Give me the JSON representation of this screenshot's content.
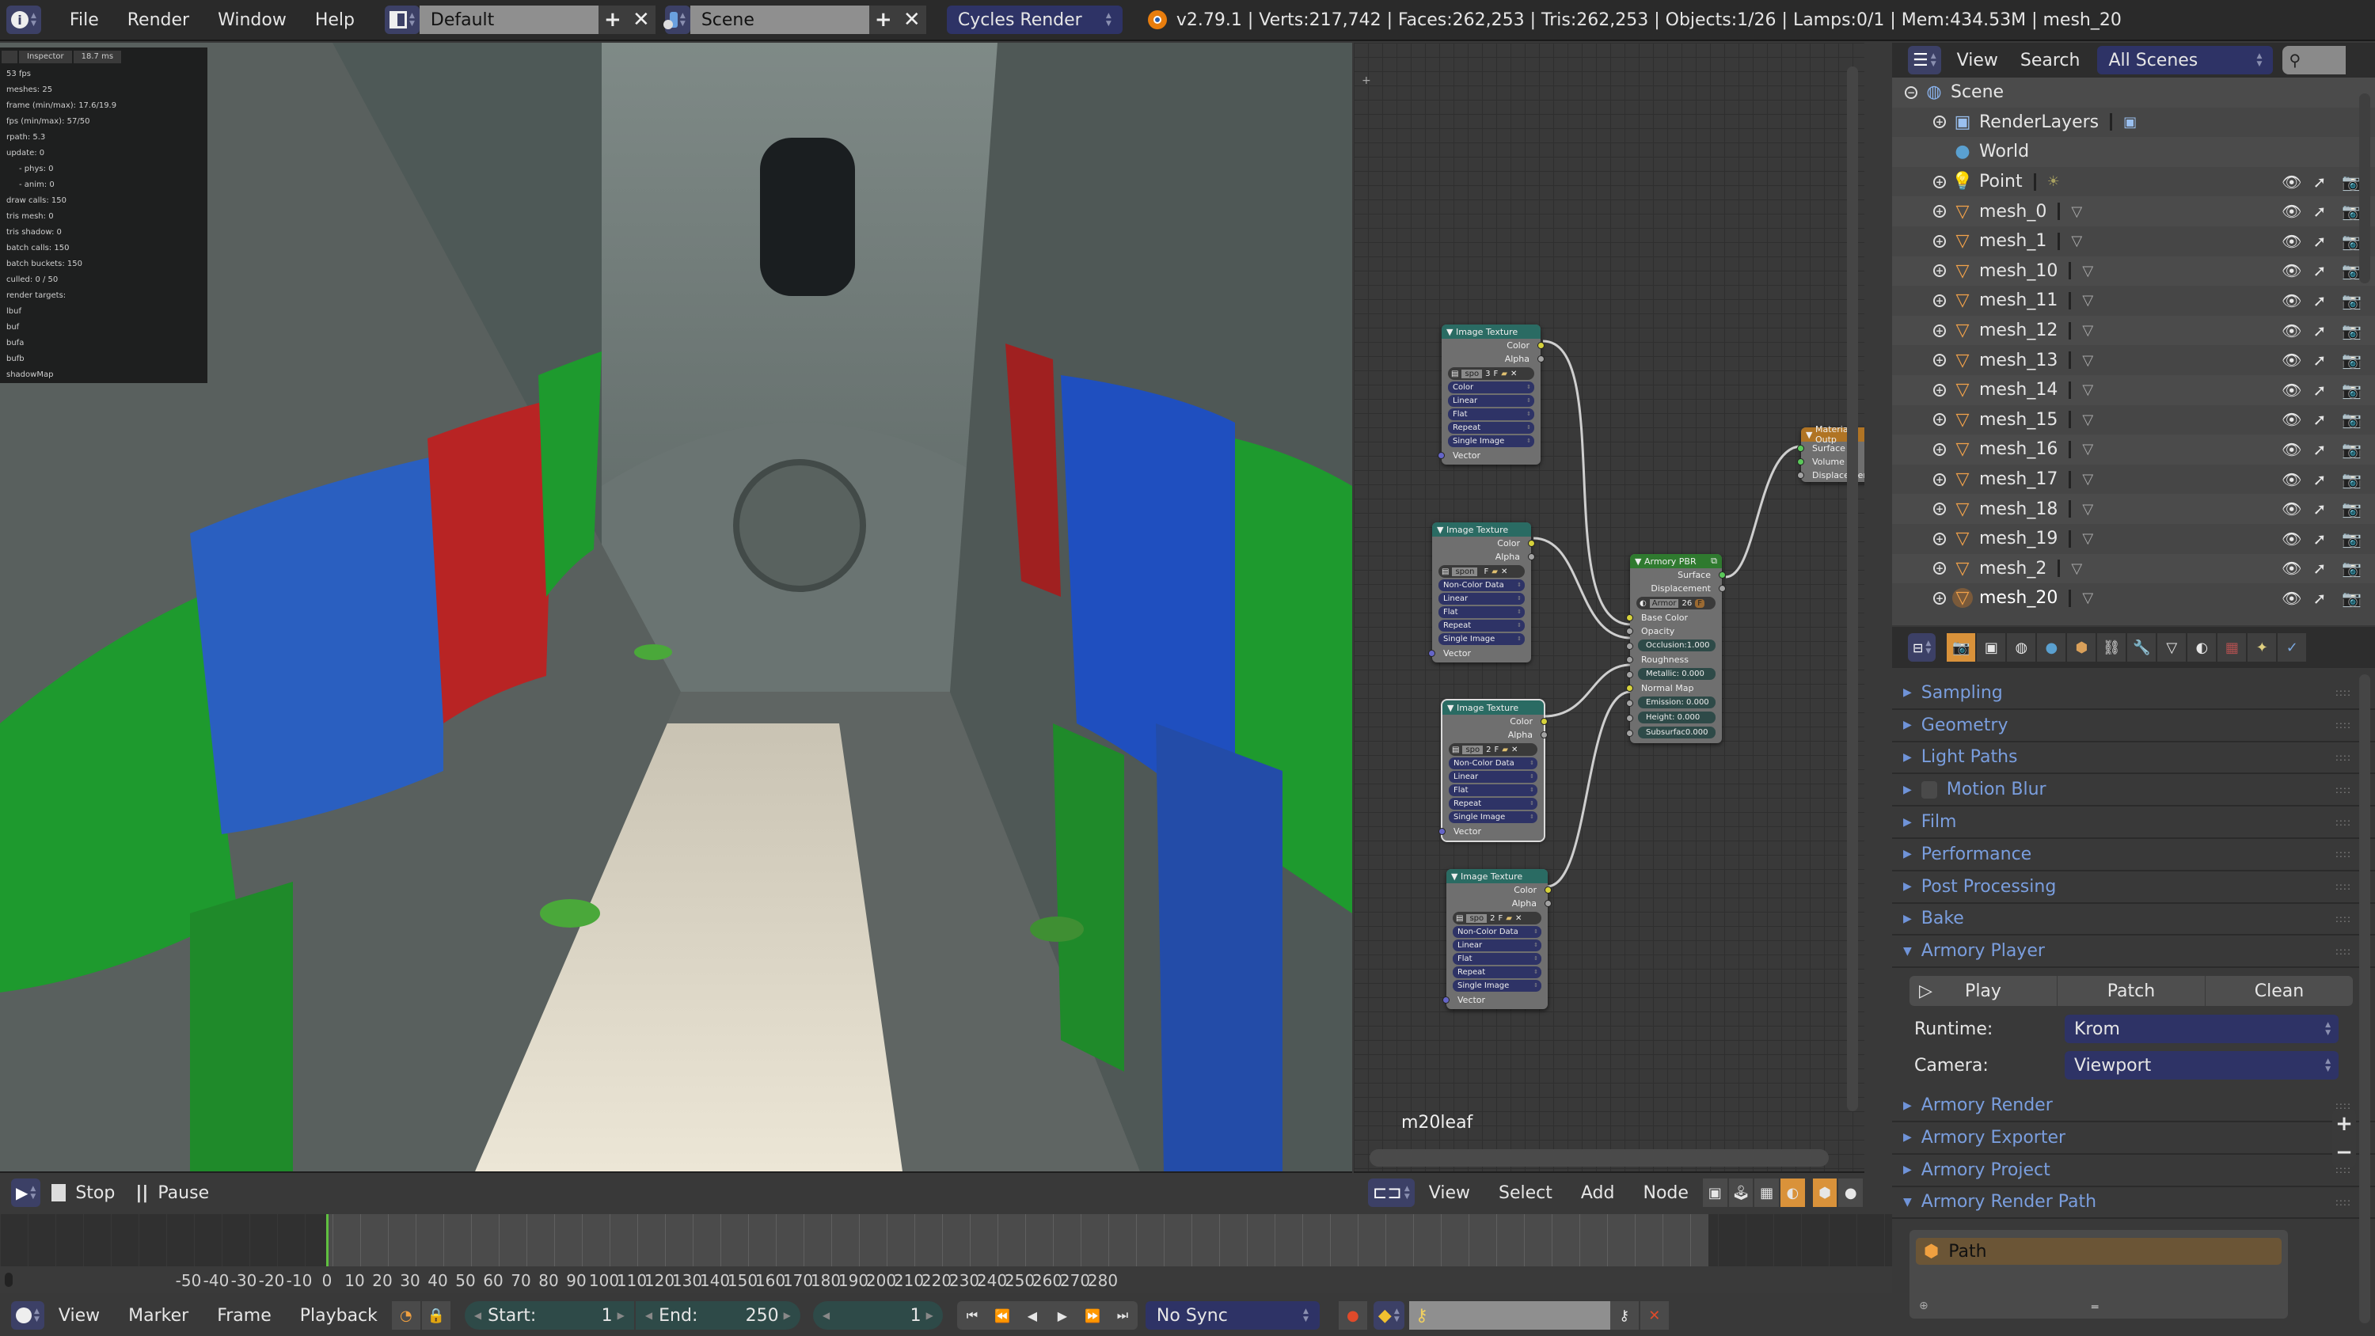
{
  "topbar": {
    "menus": [
      "File",
      "Render",
      "Window",
      "Help"
    ],
    "layout": "Default",
    "scene": "Scene",
    "engine": "Cycles Render",
    "status": "v2.79.1 | Verts:217,742 | Faces:262,253 | Tris:262,253 | Objects:1/26 | Lamps:0/1 | Mem:434.53M | mesh_20"
  },
  "inspector": {
    "tab_label": "Inspector",
    "frame_time": "18.7 ms",
    "lines": [
      {
        "text": "53 fps",
        "sub": false
      },
      {
        "text": "meshes: 25",
        "sub": false
      },
      {
        "text": "frame (min/max): 17.6/19.9",
        "sub": false
      },
      {
        "text": "fps (min/max): 57/50",
        "sub": false
      },
      {
        "text": "rpath: 5.3",
        "sub": false
      },
      {
        "text": "update: 0",
        "sub": false
      },
      {
        "text": "- phys: 0",
        "sub": true
      },
      {
        "text": "- anim: 0",
        "sub": true
      },
      {
        "text": "draw calls: 150",
        "sub": false
      },
      {
        "text": "tris mesh: 0",
        "sub": false
      },
      {
        "text": "tris shadow: 0",
        "sub": false
      },
      {
        "text": "batch calls: 150",
        "sub": false
      },
      {
        "text": "batch buckets: 150",
        "sub": false
      },
      {
        "text": "culled: 0 / 50",
        "sub": false
      },
      {
        "text": "render targets:",
        "sub": false
      },
      {
        "text": "lbuf",
        "sub": false
      },
      {
        "text": "buf",
        "sub": false
      },
      {
        "text": "bufa",
        "sub": false
      },
      {
        "text": "bufb",
        "sub": false
      },
      {
        "text": "shadowMap",
        "sub": false
      }
    ]
  },
  "viewport_header": {
    "stop": "Stop",
    "pause": "Pause"
  },
  "node_editor": {
    "material_name": "m20leaf",
    "menus": [
      "View",
      "Select",
      "Add",
      "Node"
    ],
    "image_texture_nodes": [
      {
        "title": "Image Texture",
        "outputs": [
          "Color",
          "Alpha"
        ],
        "image": "spo",
        "users": "3",
        "options": [
          "Color",
          "Linear",
          "Flat",
          "Repeat",
          "Single Image"
        ],
        "input": "Vector"
      },
      {
        "title": "Image Texture",
        "outputs": [
          "Color",
          "Alpha"
        ],
        "image": "spon",
        "users": "",
        "options": [
          "Non-Color Data",
          "Linear",
          "Flat",
          "Repeat",
          "Single Image"
        ],
        "input": "Vector"
      },
      {
        "title": "Image Texture",
        "outputs": [
          "Color",
          "Alpha"
        ],
        "image": "spo",
        "users": "2",
        "options": [
          "Non-Color Data",
          "Linear",
          "Flat",
          "Repeat",
          "Single Image"
        ],
        "input": "Vector"
      },
      {
        "title": "Image Texture",
        "outputs": [
          "Color",
          "Alpha"
        ],
        "image": "spo",
        "users": "2",
        "options": [
          "Non-Color Data",
          "Linear",
          "Flat",
          "Repeat",
          "Single Image"
        ],
        "input": "Vector"
      }
    ],
    "pbr_node": {
      "title": "Armory PBR",
      "outputs": [
        "Surface",
        "Displacement"
      ],
      "material": "Armor",
      "material_users": "26",
      "inputs": [
        "Base Color",
        "Opacity"
      ],
      "occlusion": "Occlusion:1.000",
      "roughness": "Roughness",
      "metallic": "Metallic:  0.000",
      "normal": "Normal Map",
      "emission": "Emission: 0.000",
      "height": "Height:    0.000",
      "subsurface": "Subsurfac0.000"
    },
    "output_node": {
      "title": "Material Outp",
      "inputs": [
        "Surface",
        "Volume",
        "Displacement"
      ]
    }
  },
  "outliner": {
    "menus": [
      "View",
      "Search"
    ],
    "filter": "All Scenes",
    "scene": "Scene",
    "items": [
      {
        "name": "RenderLayers",
        "type": "renderlayers",
        "visible_controls": false
      },
      {
        "name": "World",
        "type": "world",
        "visible_controls": false
      },
      {
        "name": "Point",
        "type": "lamp",
        "visible_controls": true
      },
      {
        "name": "mesh_0",
        "type": "mesh",
        "visible_controls": true
      },
      {
        "name": "mesh_1",
        "type": "mesh",
        "visible_controls": true
      },
      {
        "name": "mesh_10",
        "type": "mesh",
        "visible_controls": true
      },
      {
        "name": "mesh_11",
        "type": "mesh",
        "visible_controls": true
      },
      {
        "name": "mesh_12",
        "type": "mesh",
        "visible_controls": true
      },
      {
        "name": "mesh_13",
        "type": "mesh",
        "visible_controls": true
      },
      {
        "name": "mesh_14",
        "type": "mesh",
        "visible_controls": true
      },
      {
        "name": "mesh_15",
        "type": "mesh",
        "visible_controls": true
      },
      {
        "name": "mesh_16",
        "type": "mesh",
        "visible_controls": true
      },
      {
        "name": "mesh_17",
        "type": "mesh",
        "visible_controls": true
      },
      {
        "name": "mesh_18",
        "type": "mesh",
        "visible_controls": true
      },
      {
        "name": "mesh_19",
        "type": "mesh",
        "visible_controls": true
      },
      {
        "name": "mesh_2",
        "type": "mesh",
        "visible_controls": true
      },
      {
        "name": "mesh_20",
        "type": "mesh",
        "visible_controls": true,
        "selected": true
      }
    ]
  },
  "properties": {
    "panels_top": [
      "Sampling",
      "Geometry",
      "Light Paths",
      "Motion Blur",
      "Film",
      "Performance",
      "Post Processing",
      "Bake"
    ],
    "armory_player": {
      "title": "Armory Player",
      "buttons": [
        "Play",
        "Patch",
        "Clean"
      ],
      "runtime_label": "Runtime:",
      "runtime_value": "Krom",
      "camera_label": "Camera:",
      "camera_value": "Viewport"
    },
    "panels_mid": [
      "Armory Render",
      "Armory Exporter",
      "Armory Project"
    ],
    "render_path": {
      "title": "Armory Render Path",
      "item": "Path"
    }
  },
  "timeline": {
    "ticks": [
      -50,
      -40,
      -30,
      -20,
      -10,
      0,
      10,
      20,
      30,
      40,
      50,
      60,
      70,
      80,
      90,
      100,
      110,
      120,
      130,
      140,
      150,
      160,
      170,
      180,
      190,
      200,
      210,
      220,
      230,
      240,
      250,
      260,
      270,
      280
    ],
    "current_frame": 0,
    "menus": [
      "View",
      "Marker",
      "Frame",
      "Playback"
    ],
    "start_label": "Start:",
    "start_value": "1",
    "end_label": "End:",
    "end_value": "250",
    "frame_value": "1",
    "sync": "No Sync"
  }
}
